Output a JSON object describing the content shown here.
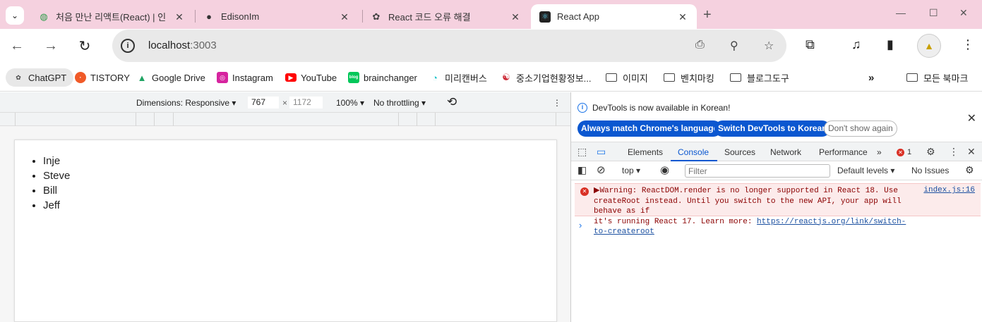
{
  "tabs": [
    {
      "title": "처음 만난 리액트(React) | 인",
      "favicon_icon": "green-circle-icon"
    },
    {
      "title": "EdisonIm",
      "favicon_icon": "github-icon"
    },
    {
      "title": "React 코드 오류 해결",
      "favicon_icon": "chatgpt-icon"
    },
    {
      "title": "React App",
      "favicon_icon": "react-icon",
      "active": true
    }
  ],
  "address": {
    "host": "localhost",
    "port": ":3003"
  },
  "bookmarks": [
    {
      "label": "ChatGPT"
    },
    {
      "label": "TISTORY"
    },
    {
      "label": "Google Drive"
    },
    {
      "label": "Instagram"
    },
    {
      "label": "YouTube"
    },
    {
      "label": "brainchanger"
    },
    {
      "label": "미리캔버스"
    },
    {
      "label": "중소기업현황정보..."
    },
    {
      "label": "이미지"
    },
    {
      "label": "벤치마킹"
    },
    {
      "label": "블로그도구"
    },
    {
      "label": "모든 북마크"
    }
  ],
  "device_toolbar": {
    "dimensions": "Dimensions: Responsive",
    "width": "767",
    "times": "×",
    "height": "1172",
    "zoom": "100%",
    "throttling": "No throttling"
  },
  "page": {
    "list": [
      "Inje",
      "Steve",
      "Bill",
      "Jeff"
    ]
  },
  "devtools": {
    "info_message": "DevTools is now available in Korean!",
    "btn_match": "Always match Chrome's language",
    "btn_switch": "Switch DevTools to Korean",
    "btn_dont_show": "Don't show again",
    "tabs": [
      "Elements",
      "Console",
      "Sources",
      "Network",
      "Performance"
    ],
    "error_count": "1",
    "context": "top",
    "filter_placeholder": "Filter",
    "levels": "Default levels",
    "issues": "No Issues",
    "error_line1": "▶Warning: ReactDOM.render is no longer supported in React 18. Use",
    "error_line2": "createRoot instead. Until you switch to the new API, your app will behave as if",
    "error_line3": "it's running React 17. Learn more: ",
    "error_link": "https://reactjs.org/link/switch-to-createroot",
    "error_source": "index.js:16",
    "prompt": "›"
  },
  "colors": {
    "tabstrip": "#f5d1df",
    "accent": "#0b57d0",
    "error": "#d93025"
  }
}
